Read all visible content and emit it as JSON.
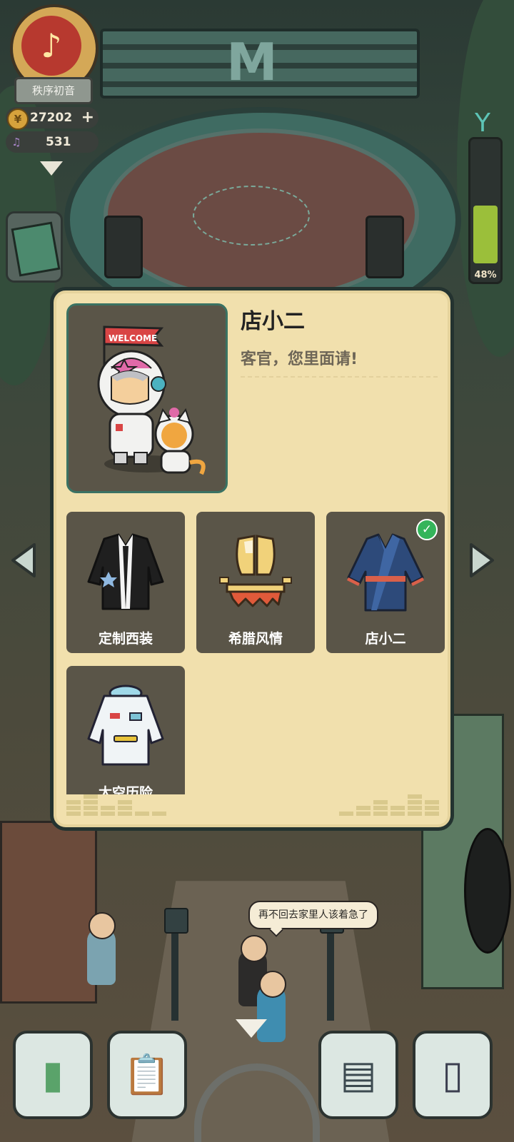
{
  "hud": {
    "player_name": "秩序初音",
    "coins": "27202",
    "coins_plus": "+",
    "notes": "531",
    "energy_percent_label": "48%",
    "energy_level": 0.48,
    "avatar_icon": "music-note-badge-icon",
    "album_icon": "record-album-icon"
  },
  "modal": {
    "character_name": "店小二",
    "character_line": "客官，您里面请!",
    "portrait_banner": "WELCOME",
    "outfits": [
      {
        "label": "定制西装",
        "icon": "tuxedo-icon",
        "selected": false
      },
      {
        "label": "希腊风情",
        "icon": "greek-armor-icon",
        "selected": false
      },
      {
        "label": "店小二",
        "icon": "blue-robe-icon",
        "selected": true
      },
      {
        "label": "太空历险",
        "icon": "space-jacket-icon",
        "selected": false
      }
    ],
    "selected_mark": "✓"
  },
  "scene": {
    "npc_speech": "再不回去家里人该着急了",
    "stage_sign_letter": "M"
  },
  "nav": {
    "buttons": [
      {
        "name": "decorate-button",
        "icon": "paint-roller-icon"
      },
      {
        "name": "task-board-button",
        "icon": "clipboard-icon"
      },
      {
        "name": "notebook-button",
        "icon": "notebook-icon"
      },
      {
        "name": "phone-button",
        "icon": "phone-icon"
      }
    ]
  },
  "colors": {
    "modal_bg": "#f1e0ad",
    "card_bg": "#5a5548",
    "check_green": "#34b45a",
    "energy_green": "#9bbf3a"
  }
}
